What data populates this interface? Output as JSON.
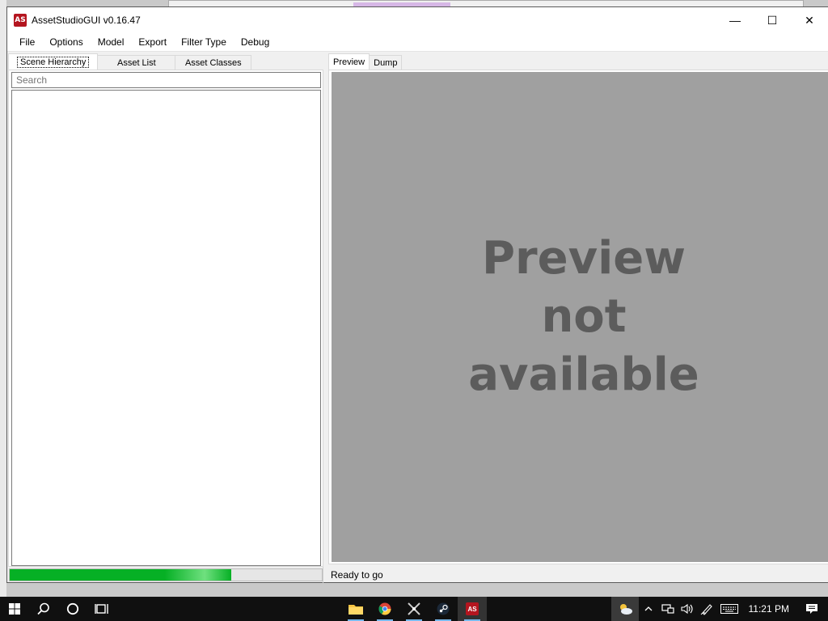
{
  "window": {
    "title": "AssetStudioGUI v0.16.47",
    "icon_label": "AS",
    "controls": {
      "minimize": "—",
      "maximize": "☐",
      "close": "✕"
    }
  },
  "menu": [
    "File",
    "Options",
    "Model",
    "Export",
    "Filter Type",
    "Debug"
  ],
  "left_tabs": [
    "Scene Hierarchy",
    "Asset List",
    "Asset Classes"
  ],
  "search": {
    "placeholder": "Search",
    "value": ""
  },
  "right_tabs": [
    "Preview",
    "Dump"
  ],
  "preview": {
    "message_lines": [
      "Preview",
      "not",
      "available"
    ]
  },
  "status": {
    "text": "Ready to go",
    "progress": 0.71
  },
  "taskbar": {
    "clock": "11:21 PM",
    "colors": {
      "progress": "#06b025",
      "preview_bg": "#a0a0a0",
      "preview_text": "#5c5c5c"
    }
  }
}
